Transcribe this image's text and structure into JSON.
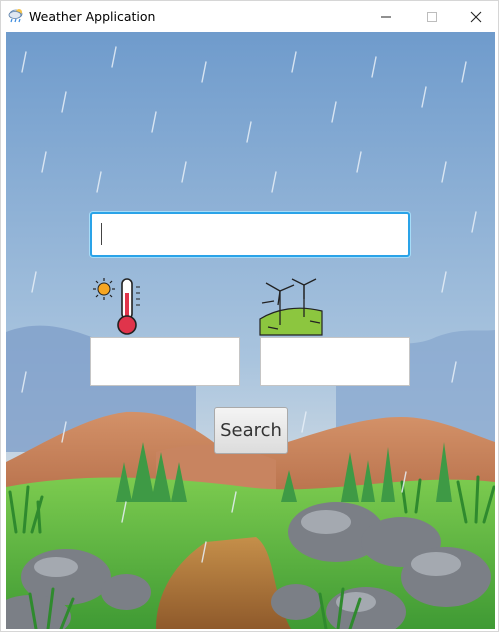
{
  "window": {
    "title": "Weather Application",
    "app_icon": "cloud-rain-icon",
    "controls": [
      "minimize-icon",
      "maximize-icon",
      "close-icon"
    ]
  },
  "form": {
    "city_input": {
      "value": "",
      "placeholder": ""
    },
    "temperature_output": {
      "value": ""
    },
    "wind_output": {
      "value": ""
    },
    "temperature_icon": "thermometer-sun-icon",
    "wind_icon": "wind-turbine-icon",
    "search_label": "Search"
  },
  "background": "rainy-landscape",
  "colors": {
    "focus_border": "#2aa3e8",
    "sky": "#7fa8d4",
    "mountain": "#c9805a",
    "grass": "#5fb845"
  }
}
